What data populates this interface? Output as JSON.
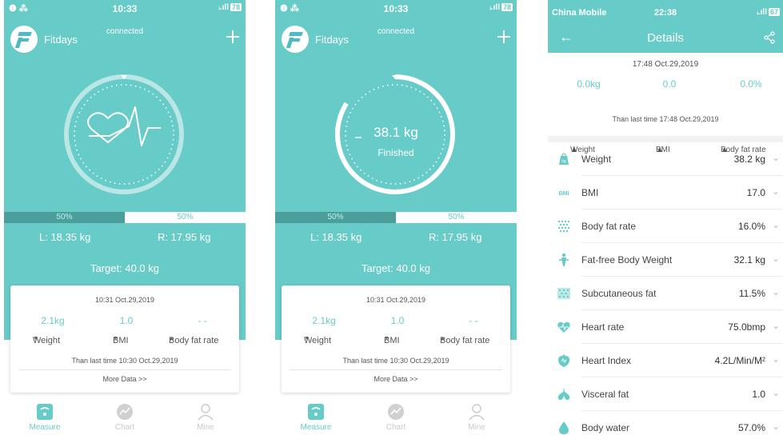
{
  "status_bar": {
    "time": "10:33",
    "left_icons": "❶ ⁂",
    "signal": "ᵢ.ıll",
    "battery": "78"
  },
  "app": {
    "name": "Fitdays",
    "connection": "connected"
  },
  "screen_left": {
    "split": {
      "left_pct": "50%",
      "right_pct": "50%"
    },
    "left_weight": "L: 18.35 kg",
    "right_weight": "R: 17.95 kg",
    "target": "Target: 40.0 kg"
  },
  "screen_mid": {
    "weight_value": "38.1 kg",
    "status": "Finished",
    "split": {
      "left_pct": "50%",
      "right_pct": "50%"
    },
    "left_weight": "L: 18.35 kg",
    "right_weight": "R: 17.95 kg",
    "target": "Target: 40.0 kg"
  },
  "card": {
    "timestamp": "10:31 Oct.29,2019",
    "weight_change": "2.1kg",
    "bmi_change": "1.0",
    "fat_change": "- -",
    "weight_label": "Weight",
    "bmi_label": "BMI",
    "fat_label": "Body fat rate",
    "since": "Than last time 10:30 Oct.29,2019",
    "more": "More Data >>"
  },
  "tabs": [
    {
      "label": "Measure",
      "icon": "scale-icon",
      "active": true
    },
    {
      "label": "Chart",
      "icon": "chart-icon",
      "active": false
    },
    {
      "label": "Mine",
      "icon": "person-icon",
      "active": false
    }
  ],
  "details": {
    "status_bar": {
      "carrier": "China Mobile",
      "time": "22:38",
      "signal": "ᵢ.ıll",
      "battery": "67"
    },
    "title": "Details",
    "timestamp": "17:48 Oct.29,2019",
    "weight_change": "0.0kg",
    "bmi_change": "0.0",
    "fat_change": "0.0%",
    "weight_label": "Weight",
    "bmi_label": "BMI",
    "fat_label": "Body fat rate",
    "since": "Than last time 17:48 Oct.29,2019",
    "rows": [
      {
        "label": "Weight",
        "value": "38.2 kg",
        "icon": "weight-icon"
      },
      {
        "label": "BMI",
        "value": "17.0",
        "icon": "bmi-icon"
      },
      {
        "label": "Body fat rate",
        "value": "16.0%",
        "icon": "body-fat-icon"
      },
      {
        "label": "Fat-free Body Weight",
        "value": "32.1 kg",
        "icon": "fat-free-body-icon"
      },
      {
        "label": "Subcutaneous fat",
        "value": "11.5%",
        "icon": "subcutaneous-fat-icon"
      },
      {
        "label": "Heart rate",
        "value": "75.0bmp",
        "icon": "heart-rate-icon"
      },
      {
        "label": "Heart Index",
        "value": "4.2L/Min/M²",
        "icon": "heart-index-icon"
      },
      {
        "label": "Visceral fat",
        "value": "1.0",
        "icon": "visceral-fat-icon"
      },
      {
        "label": "Body water",
        "value": "57.0%",
        "icon": "body-water-icon"
      }
    ]
  },
  "colors": {
    "accent": "#67cbc7",
    "dark_split": "#4a9f9c"
  }
}
